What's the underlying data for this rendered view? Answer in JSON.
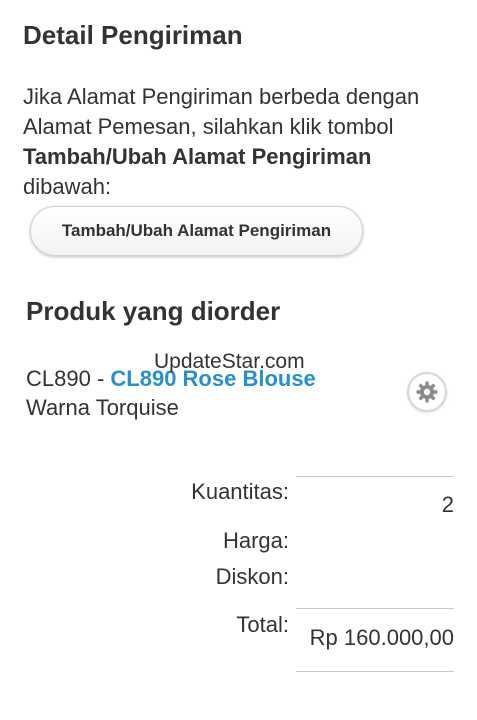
{
  "shipping": {
    "title": "Detail Pengiriman",
    "text_part1": "Jika Alamat Pengiriman berbeda dengan Alamat Pemesan, silahkan klik tombol ",
    "text_bold": "Tambah/Ubah Alamat Pengiriman",
    "text_part2": " dibawah:",
    "button_label": "Tambah/Ubah Alamat Pengiriman"
  },
  "watermark": "UpdateStar.com",
  "products": {
    "title": "Produk yang diorder",
    "item": {
      "code": "CL890 - ",
      "name": "CL890 Rose Blouse",
      "variant": "Warna Torquise",
      "settings_icon": "gear-icon"
    }
  },
  "summary": {
    "quantity_label": "Kuantitas:",
    "quantity_value": "2",
    "price_label": "Harga:",
    "discount_label": "Diskon:",
    "total_label": "Total:",
    "total_value": "Rp 160.000,00"
  },
  "colors": {
    "link": "#2a8fd1",
    "text": "#333333"
  }
}
